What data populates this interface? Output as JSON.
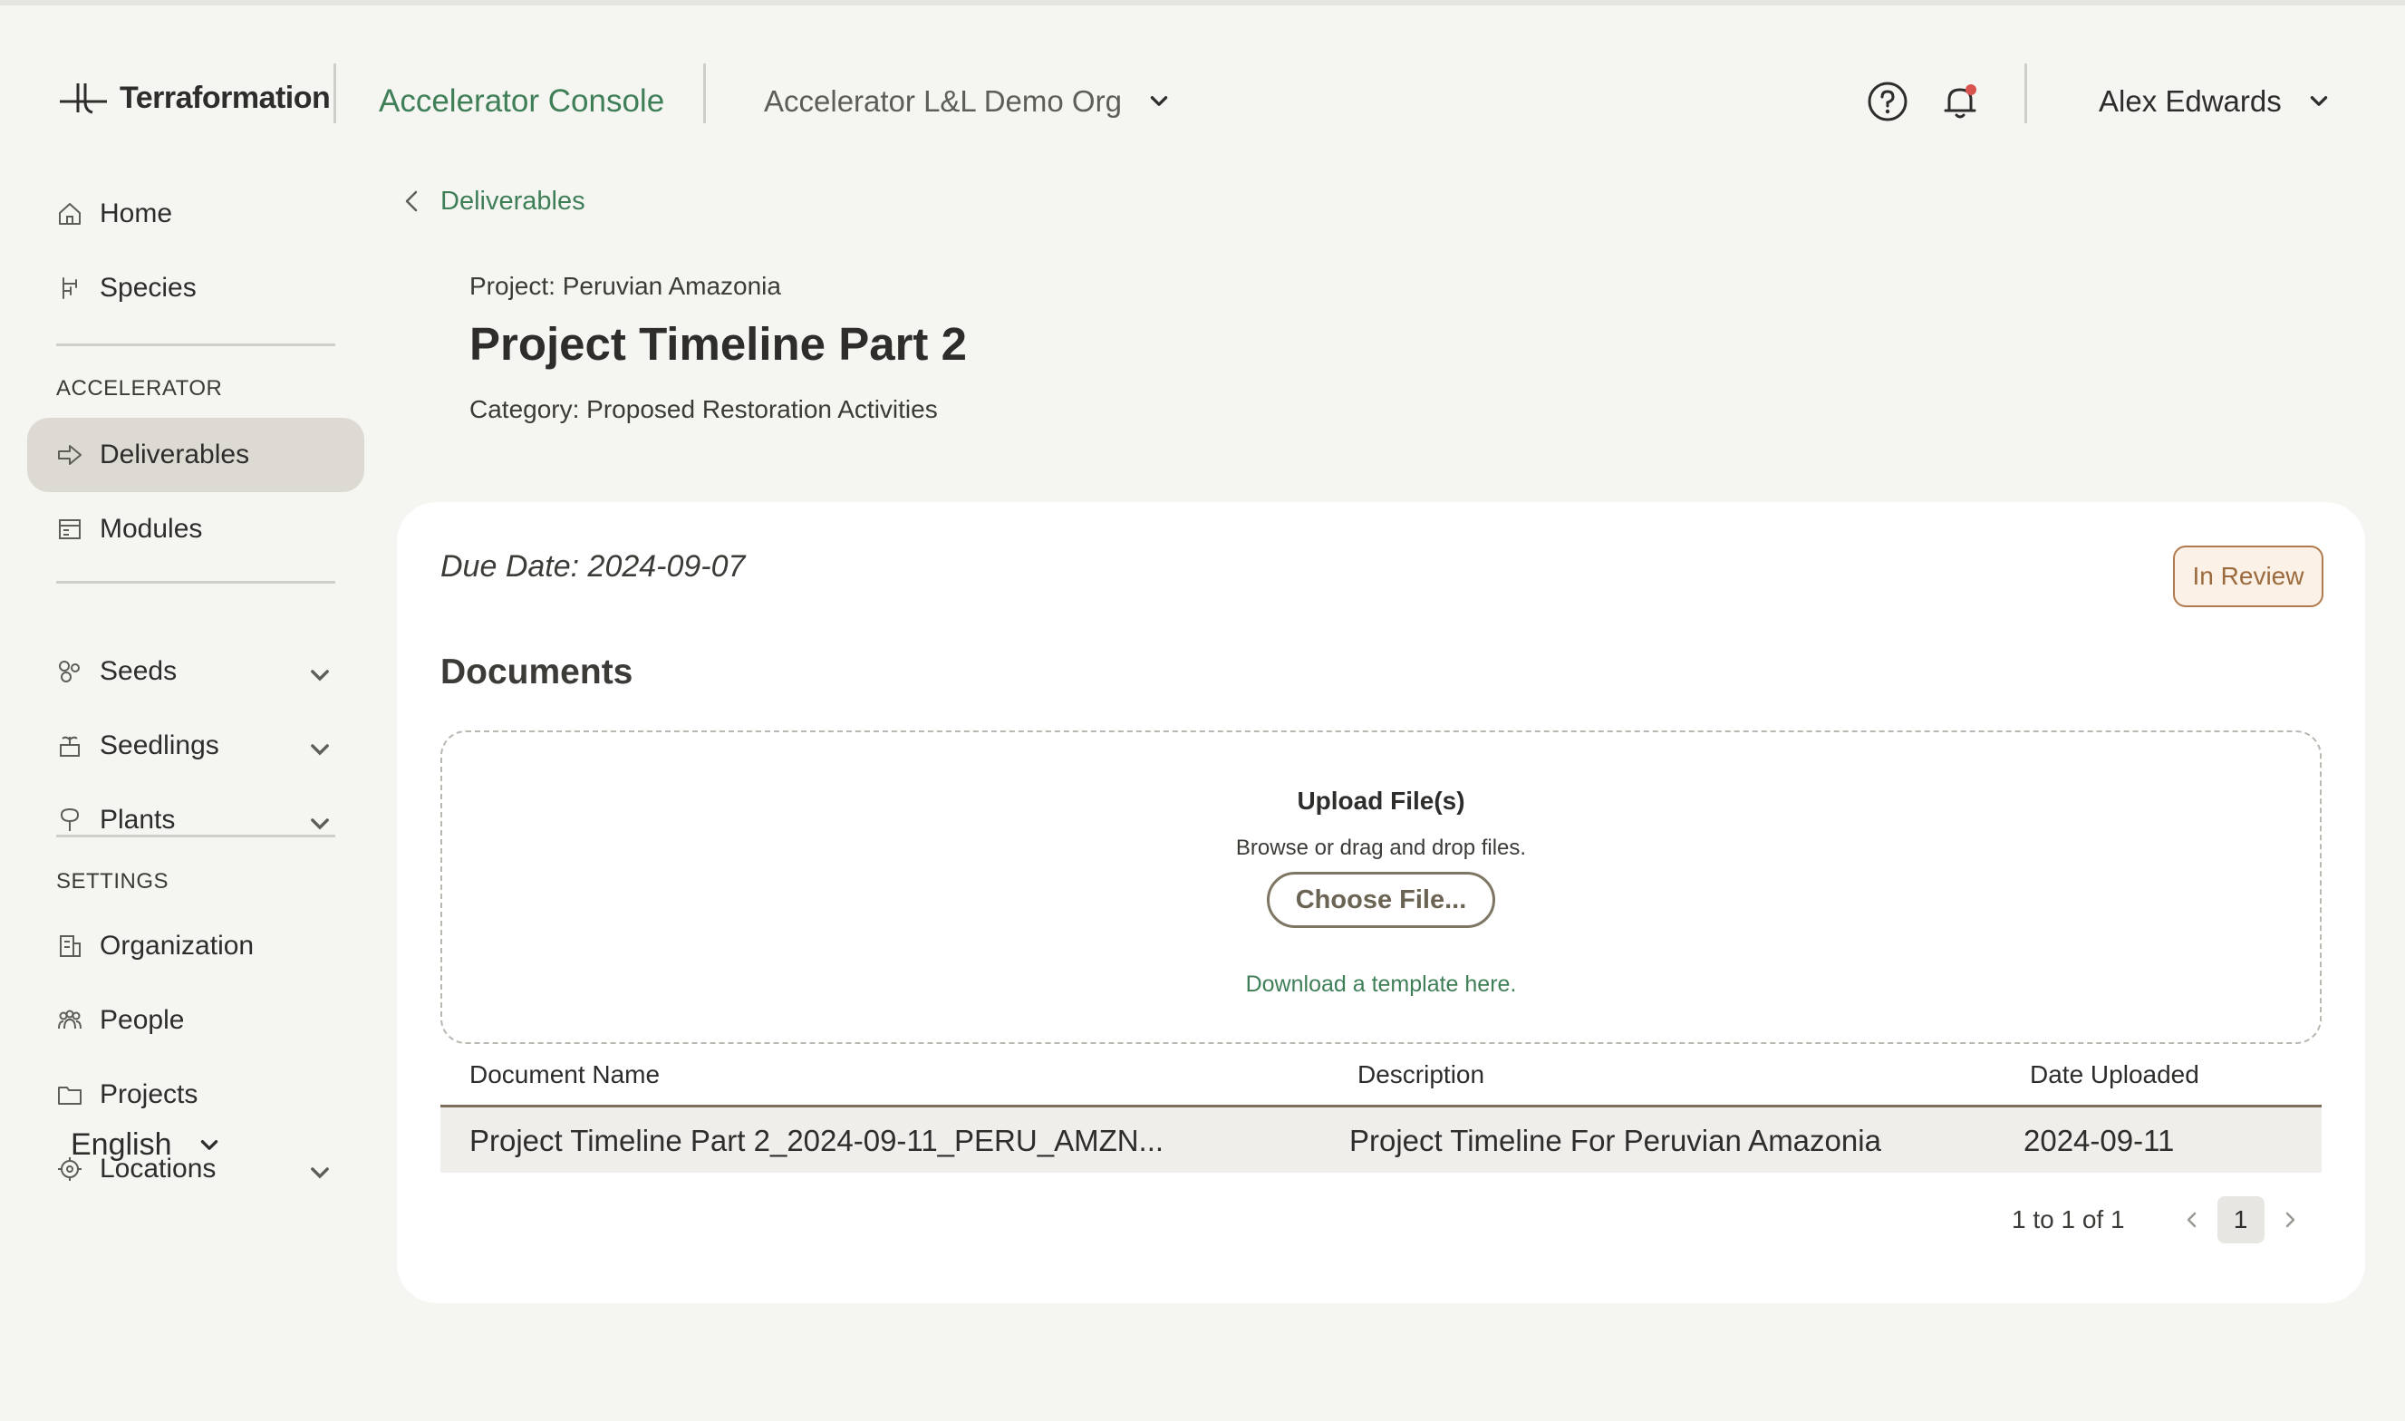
{
  "header": {
    "brand": "Terraformation",
    "console_title": "Accelerator Console",
    "org_name": "Accelerator L&L Demo Org",
    "user_name": "Alex Edwards"
  },
  "sidebar": {
    "items_top": [
      {
        "label": "Home",
        "icon": "home-icon"
      },
      {
        "label": "Species",
        "icon": "species-icon"
      }
    ],
    "accelerator_section": "ACCELERATOR",
    "accelerator_items": [
      {
        "label": "Deliverables",
        "icon": "deliverables-icon",
        "active": true
      },
      {
        "label": "Modules",
        "icon": "modules-icon"
      }
    ],
    "inventory_items": [
      {
        "label": "Seeds",
        "icon": "seeds-icon"
      },
      {
        "label": "Seedlings",
        "icon": "seedlings-icon"
      },
      {
        "label": "Plants",
        "icon": "plants-icon"
      }
    ],
    "settings_section": "SETTINGS",
    "settings_items": [
      {
        "label": "Organization",
        "icon": "organization-icon"
      },
      {
        "label": "People",
        "icon": "people-icon"
      },
      {
        "label": "Projects",
        "icon": "projects-icon"
      },
      {
        "label": "Locations",
        "icon": "locations-icon"
      }
    ],
    "language": "English"
  },
  "main": {
    "back_label": "Deliverables",
    "project_line": "Project: Peruvian Amazonia",
    "title": "Project Timeline Part 2",
    "category_line": "Category: Proposed Restoration Activities",
    "card": {
      "due_date": "Due Date: 2024-09-07",
      "status": "In Review",
      "documents_heading": "Documents",
      "upload": {
        "title": "Upload File(s)",
        "subtitle": "Browse or drag and drop files.",
        "button": "Choose File...",
        "template_link": "Download a template here."
      },
      "table": {
        "columns": [
          "Document Name",
          "Description",
          "Date Uploaded"
        ],
        "rows": [
          [
            "Project Timeline Part 2_2024-09-11_PERU_AMZN...",
            "Project Timeline For Peruvian Amazonia",
            "2024-09-11"
          ]
        ]
      },
      "pagination": {
        "range": "1 to 1 of 1",
        "current_page": "1"
      }
    }
  },
  "colors": {
    "accent_green": "#3f7f58",
    "active_nav_bg": "#dcdad3",
    "status_border": "#b07a4c",
    "notification_dot": "#d9534f"
  }
}
